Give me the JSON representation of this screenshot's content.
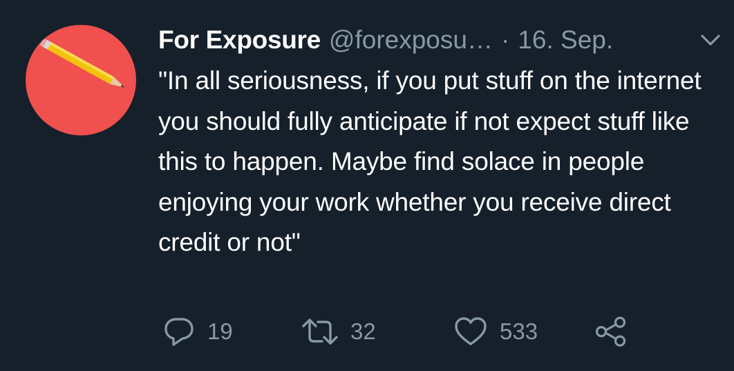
{
  "tweet": {
    "author": {
      "display_name": "For Exposure",
      "handle": "@forexposu…",
      "avatar_color": "#f0504e"
    },
    "separator": "·",
    "date": "16. Sep.",
    "text": "\"In all seriousness, if you put stuff on the internet you should fully anticipate if not expect stuff like this to happen. Maybe find solace in people enjoying your work whether you receive direct credit or not\"",
    "actions": {
      "reply": {
        "icon": "reply-icon",
        "count": "19"
      },
      "retweet": {
        "icon": "retweet-icon",
        "count": "32"
      },
      "like": {
        "icon": "heart-icon",
        "count": "533"
      },
      "share": {
        "icon": "share-icon"
      }
    },
    "menu_icon": "chevron-down-icon"
  },
  "colors": {
    "background": "#15202b",
    "text_primary": "#ffffff",
    "text_secondary": "#8899a6"
  }
}
